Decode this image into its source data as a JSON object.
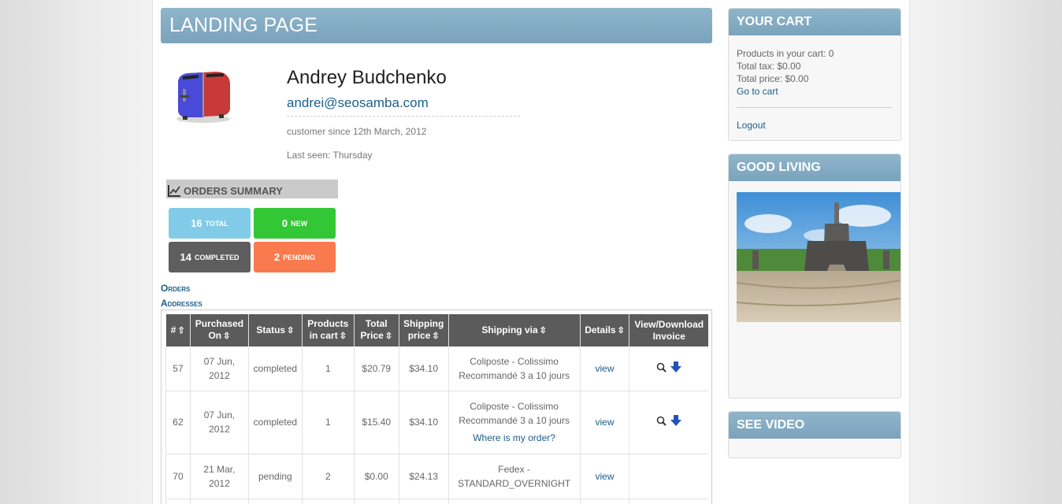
{
  "page": {
    "title": "LANDING PAGE"
  },
  "profile": {
    "name": "Andrey Budchenko",
    "email": "andrei@seosamba.com",
    "customer_since": "customer since 12th March, 2012",
    "last_seen": "Last seen: Thursday",
    "avatar_icon": "toaster-image"
  },
  "orders_summary": {
    "title": "ORDERS SUMMARY",
    "icon": "chart-icon",
    "total": {
      "count": "16",
      "label": "total",
      "color": "#82cbe8"
    },
    "new": {
      "count": "0",
      "label": "new",
      "color": "#33c635"
    },
    "completed": {
      "count": "14",
      "label": "completed",
      "color": "#5e5e5e"
    },
    "pending": {
      "count": "2",
      "label": "pending",
      "color": "#f97a4e"
    }
  },
  "links": {
    "orders": "Orders",
    "addresses": "Addresses"
  },
  "orders_table": {
    "headers": {
      "id": "#",
      "purchased_on": "Purchased On",
      "status": "Status",
      "products": "Products in cart",
      "total_price": "Total Price",
      "shipping_price": "Shipping price",
      "shipping_via": "Shipping via",
      "details": "Details",
      "invoice": "View/Download Invoice"
    },
    "rows": [
      {
        "id": "57",
        "date": "07 Jun, 2012",
        "status": "completed",
        "products": "1",
        "total": "$20.79",
        "shipping": "$34.10",
        "via": "Coliposte - Colissimo Recommandé 3 a 10 jours",
        "via_link": "",
        "details": "view",
        "invoice": true
      },
      {
        "id": "62",
        "date": "07 Jun, 2012",
        "status": "completed",
        "products": "1",
        "total": "$15.40",
        "shipping": "$34.10",
        "via": "Coliposte - Colissimo Recommandé 3 a 10 jours",
        "via_link": "Where is my order?",
        "details": "view",
        "invoice": true
      },
      {
        "id": "70",
        "date": "21 Mar, 2012",
        "status": "pending",
        "products": "2",
        "total": "$0.00",
        "shipping": "$24.13",
        "via": "Fedex - STANDARD_OVERNIGHT",
        "via_link": "",
        "details": "view",
        "invoice": false
      }
    ]
  },
  "cart": {
    "title": "YOUR CART",
    "products": "Products in your cart: 0",
    "tax": "Total tax: $0.00",
    "price": "Total price: $0.00",
    "go_to_cart": "Go to cart",
    "logout": "Logout"
  },
  "good_living": {
    "title": "GOOD LIVING",
    "image": "temple-photo"
  },
  "see_video": {
    "title": "SEE VIDEO"
  },
  "colors": {
    "accent": "#7aa3bc",
    "link": "#1a5f8a",
    "table_header": "#5b5b5b"
  }
}
